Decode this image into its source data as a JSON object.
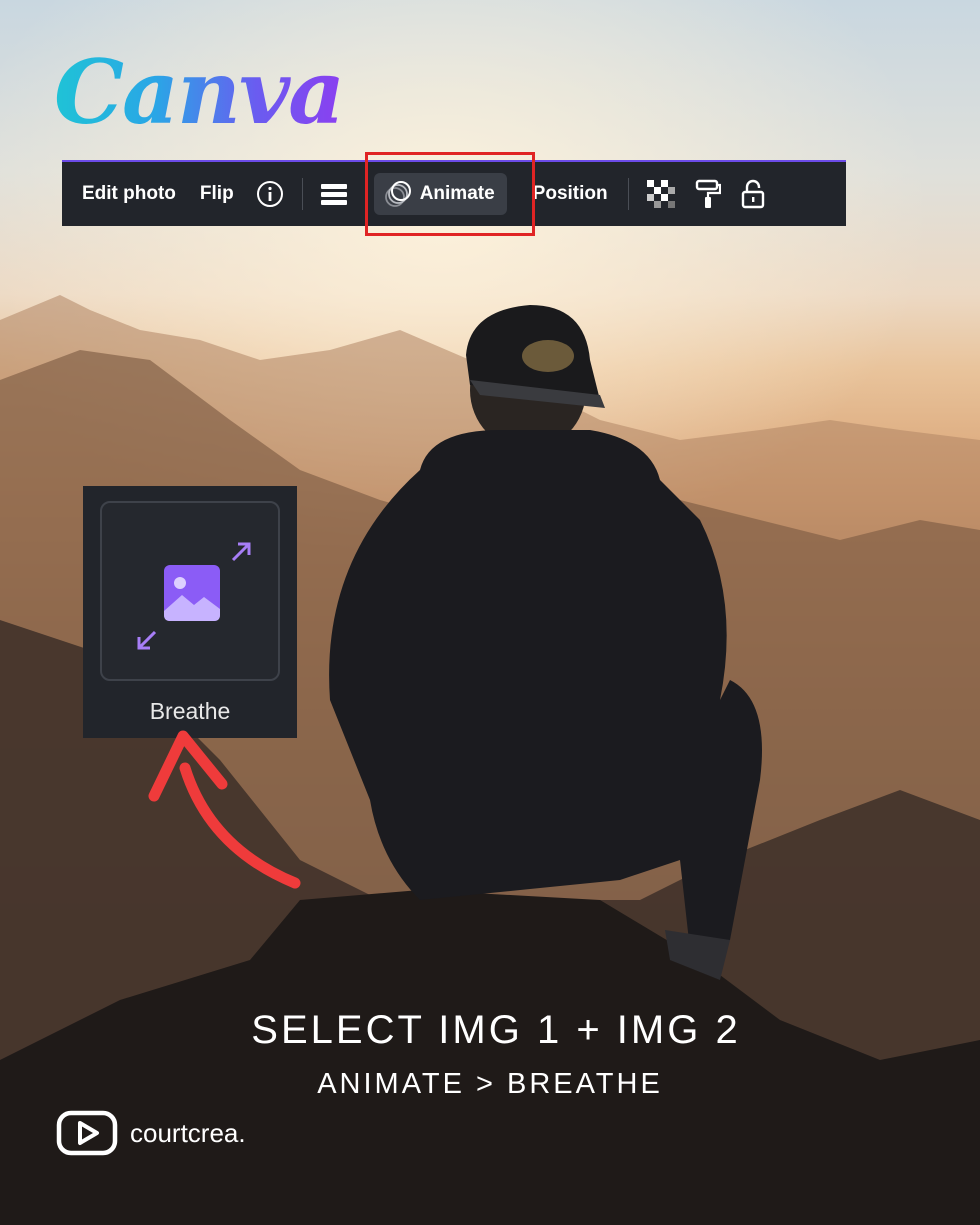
{
  "logo": {
    "text": "Canva"
  },
  "toolbar": {
    "edit_photo": "Edit photo",
    "flip": "Flip",
    "animate": "Animate",
    "position": "Position",
    "icons": [
      "info-icon",
      "menu-lines-icon",
      "animate-circles-icon",
      "transparency-checker-icon",
      "paint-roller-icon",
      "lock-open-icon"
    ]
  },
  "animation_option": {
    "label": "Breathe"
  },
  "caption": {
    "line1": "SELECT IMG 1 + IMG 2",
    "line2": "ANIMATE > BREATHE"
  },
  "brand": {
    "handle": "courtcrea."
  },
  "colors": {
    "toolbar_bg": "#22252b",
    "highlight": "#e02424",
    "accent_purple": "#8b5cf6",
    "arrow_red": "#ef3b3b"
  }
}
